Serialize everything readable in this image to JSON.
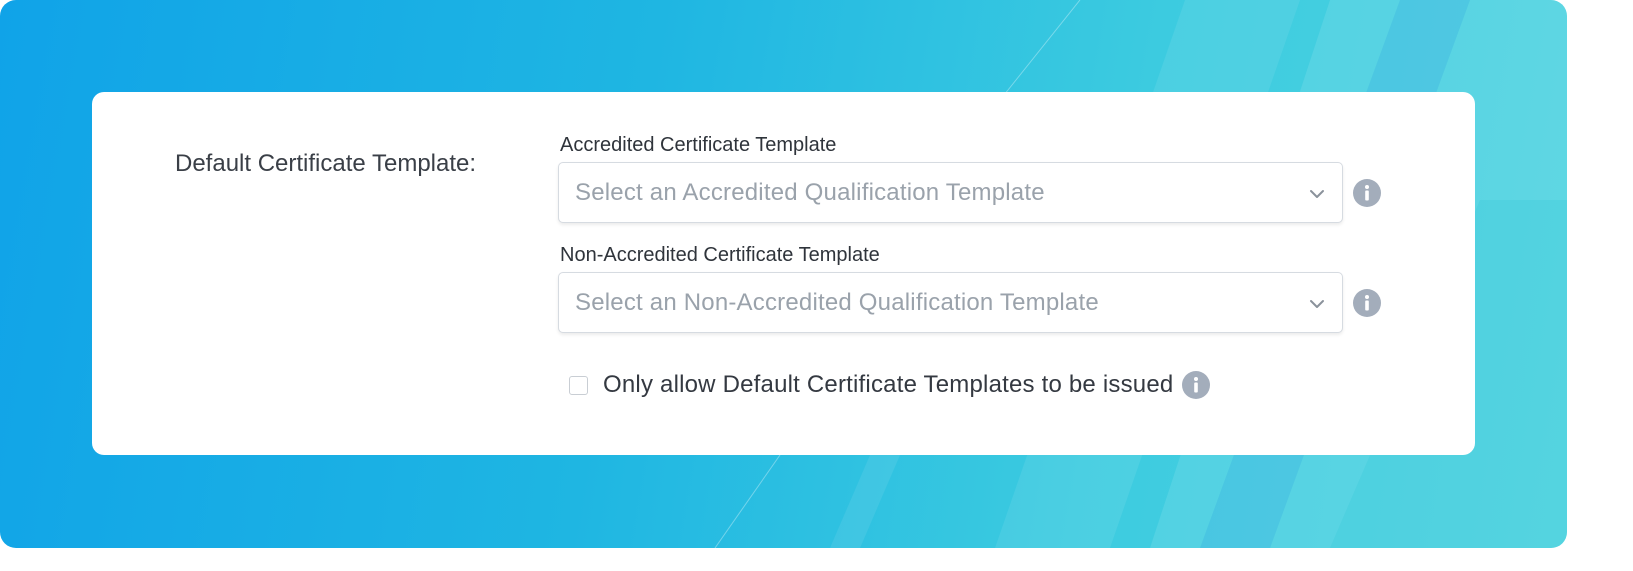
{
  "section": {
    "label": "Default Certificate Template:"
  },
  "accredited": {
    "label": "Accredited Certificate Template",
    "placeholder": "Select an Accredited Qualification Template",
    "info_icon": "info-icon"
  },
  "non_accredited": {
    "label": "Non-Accredited Certificate Template",
    "placeholder": "Select an Non-Accredited Qualification Template",
    "info_icon": "info-icon"
  },
  "only_default": {
    "label": "Only allow Default Certificate Templates to be issued",
    "checked": false,
    "info_icon": "info-icon"
  },
  "colors": {
    "background_start": "#10a3e8",
    "background_end": "#4fd4e0",
    "card": "#ffffff",
    "placeholder_text": "#9aa2ab",
    "info_icon": "#a3adbb"
  }
}
